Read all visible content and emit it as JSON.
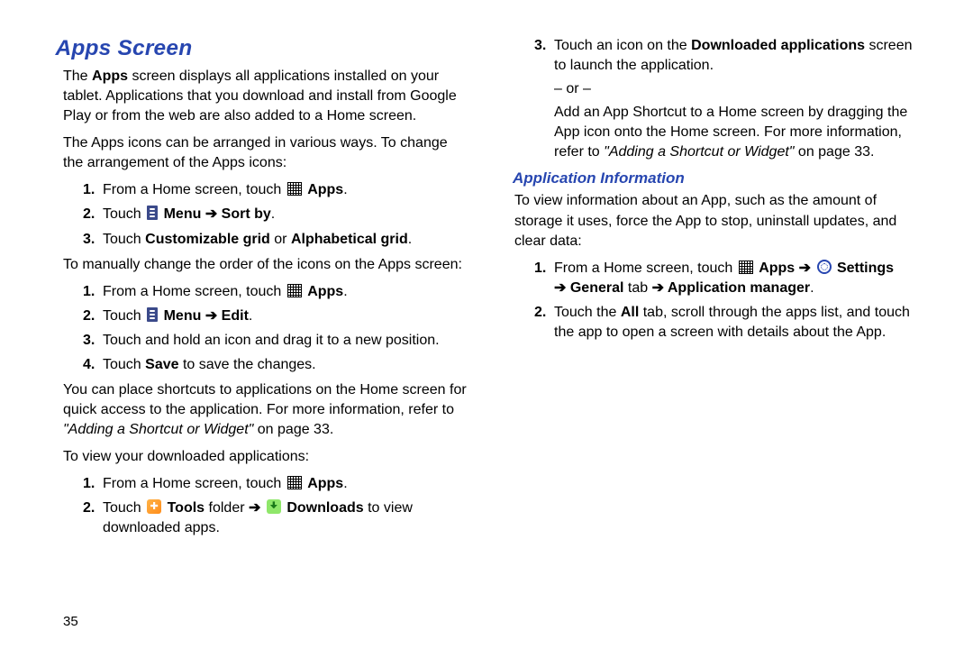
{
  "page_number": "35",
  "h1": "Apps Screen",
  "p1a": "The ",
  "p1b": "Apps",
  "p1c": " screen displays all applications installed on your tablet. Applications that you download and install from Google Play or from the web are also added to a Home screen.",
  "p2": "The Apps icons can be arranged in various ways. To change the arrangement of the Apps icons:",
  "list1": {
    "i1a": "From a Home screen, touch ",
    "i1_apps": "Apps",
    "i1b": ".",
    "i2a": "Touch ",
    "i2_menu": "Menu",
    "i2_arrow": " ➔ ",
    "i2_sortby": "Sort by",
    "i2b": ".",
    "i3a": "Touch ",
    "i3_cg": "Customizable grid",
    "i3_or": " or ",
    "i3_ag": "Alphabetical grid",
    "i3b": "."
  },
  "p3": "To manually change the order of the icons on the Apps screen:",
  "list2": {
    "i1a": "From a Home screen, touch ",
    "i1_apps": "Apps",
    "i1b": ".",
    "i2a": "Touch ",
    "i2_menu": "Menu",
    "i2_arrow": " ➔ ",
    "i2_edit": "Edit",
    "i2b": ".",
    "i3": "Touch and hold an icon and drag it to a new position.",
    "i4a": "Touch ",
    "i4_save": "Save",
    "i4b": " to save the changes."
  },
  "p4a": "You can place shortcuts to applications on the Home screen for quick access to the application. For more information, refer to ",
  "p4_ref": "\"Adding a Shortcut or Widget\"",
  "p4b": " on page 33.",
  "p5": "To view your downloaded applications:",
  "list3": {
    "i1a": "From a Home screen, touch ",
    "i1_apps": "Apps",
    "i1b": ".",
    "i2a": "Touch ",
    "i2_tools": "Tools",
    "i2_folder": " folder ",
    "i2_arrow": "➔ ",
    "i2_downloads": "Downloads",
    "i2b": " to view downloaded apps.",
    "i3a": "Touch an icon on the ",
    "i3_da": "Downloaded applications",
    "i3b": " screen to launch the application.",
    "i3_or": "– or –",
    "i3c": "Add an App Shortcut to a Home screen by dragging the App icon onto the Home screen. For more information, refer to ",
    "i3_ref": "\"Adding a Shortcut or Widget\"",
    "i3d": " on page 33."
  },
  "h2": "Application Information",
  "p6": "To view information about an App, such as the amount of storage it uses, force the App to stop, uninstall updates, and clear data:",
  "list4": {
    "i1a": "From a Home screen, touch ",
    "i1_apps": "Apps",
    "i1_arrow1": " ➔ ",
    "i1_settings": "Settings",
    "i1_arrow2": " ➔ ",
    "i1_general": "General",
    "i1_tab": " tab ",
    "i1_arrow3": "➔ ",
    "i1_appmgr": "Application manager",
    "i1b": ".",
    "i2a": "Touch the ",
    "i2_all": "All",
    "i2b": " tab, scroll through the apps list, and touch the app to open a screen with details about the App."
  }
}
